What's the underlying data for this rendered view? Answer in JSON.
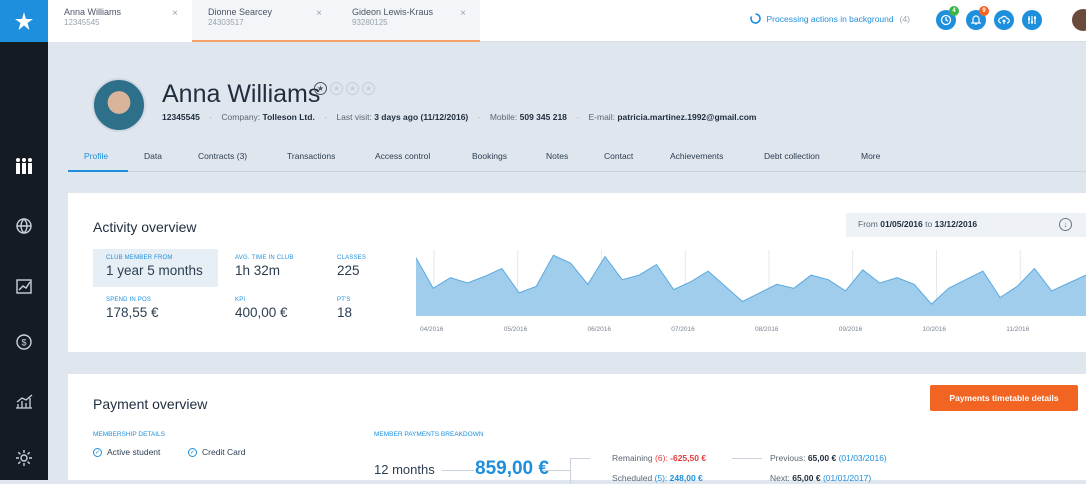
{
  "tabs": [
    {
      "name": "Anna Williams",
      "id": "12345545"
    },
    {
      "name": "Dionne Searcey",
      "id": "24303517"
    },
    {
      "name": "Gideon Lewis-Kraus",
      "id": "93280125"
    }
  ],
  "tab_close": "×",
  "processing": {
    "label": "Processing actions in background",
    "count": "(4)"
  },
  "badges": {
    "notif1": "4",
    "notif2": "9"
  },
  "colors": {
    "accent": "#1e8fdc",
    "orange": "#f26422",
    "sidebar": "#151b23",
    "chart_fill": "#9fcdeb",
    "chart_line": "#5aa9e0"
  },
  "profile": {
    "name": "Anna Williams",
    "id": "12345545",
    "company_label": "Company:",
    "company": "Tolleson Ltd.",
    "last_visit_label": "Last visit:",
    "last_visit": "3 days ago (11/12/2016)",
    "mobile_label": "Mobile:",
    "mobile": "509 345 218",
    "email_label": "E-mail:",
    "email": "patricia.martinez.1992@gmail.com",
    "rating": 1,
    "rating_max": 4
  },
  "subnav": [
    "Profile",
    "Data",
    "Contracts (3)",
    "Transactions",
    "Access control",
    "Bookings",
    "Notes",
    "Contact",
    "Achievements",
    "Debt collection",
    "More"
  ],
  "activity": {
    "title": "Activity overview",
    "date_from_label": "From",
    "date_from": "01/05/2016",
    "date_to_label": "to",
    "date_to": "13/12/2016",
    "stats": [
      {
        "label": "Club member from",
        "value": "1 year 5 months"
      },
      {
        "label": "Avg. time in club",
        "value": "1h 32m"
      },
      {
        "label": "Classes",
        "value": "225"
      },
      {
        "label": "Spend in POS",
        "value": "178,55 €"
      },
      {
        "label": "KPI",
        "value": "400,00 €"
      },
      {
        "label": "PT's",
        "value": "18"
      }
    ]
  },
  "chart_data": {
    "type": "area",
    "x": [
      "04/2016",
      "05/2016",
      "06/2016",
      "07/2016",
      "08/2016",
      "09/2016",
      "10/2016",
      "11/2016"
    ],
    "values": [
      0.88,
      0.42,
      0.58,
      0.5,
      0.6,
      0.72,
      0.35,
      0.45,
      0.92,
      0.8,
      0.48,
      0.9,
      0.55,
      0.62,
      0.78,
      0.4,
      0.52,
      0.68,
      0.45,
      0.22,
      0.35,
      0.48,
      0.42,
      0.62,
      0.55,
      0.38,
      0.7,
      0.5,
      0.58,
      0.48,
      0.18,
      0.42,
      0.55,
      0.68,
      0.28,
      0.45,
      0.72,
      0.38,
      0.5,
      0.62
    ],
    "ylim": [
      0,
      1
    ],
    "grid": true
  },
  "payment": {
    "title": "Payment overview",
    "button": "Payments timetable details",
    "membership_label": "Membership details",
    "options": [
      "Active student",
      "Credit Card"
    ],
    "breakdown_label": "Member payments breakdown",
    "months": "12 months",
    "total": "859,00 €",
    "remaining_label": "Remaining",
    "remaining_count": "(6):",
    "remaining_value": "-625,50 €",
    "scheduled_label": "Scheduled",
    "scheduled_count": "(5):",
    "scheduled_value": "248,00 €",
    "previous_label": "Previous:",
    "previous_value": "65,00 €",
    "previous_date": "(01/03/2016)",
    "next_label": "Next:",
    "next_value": "65,00 €",
    "next_date": "(01/01/2017)"
  }
}
